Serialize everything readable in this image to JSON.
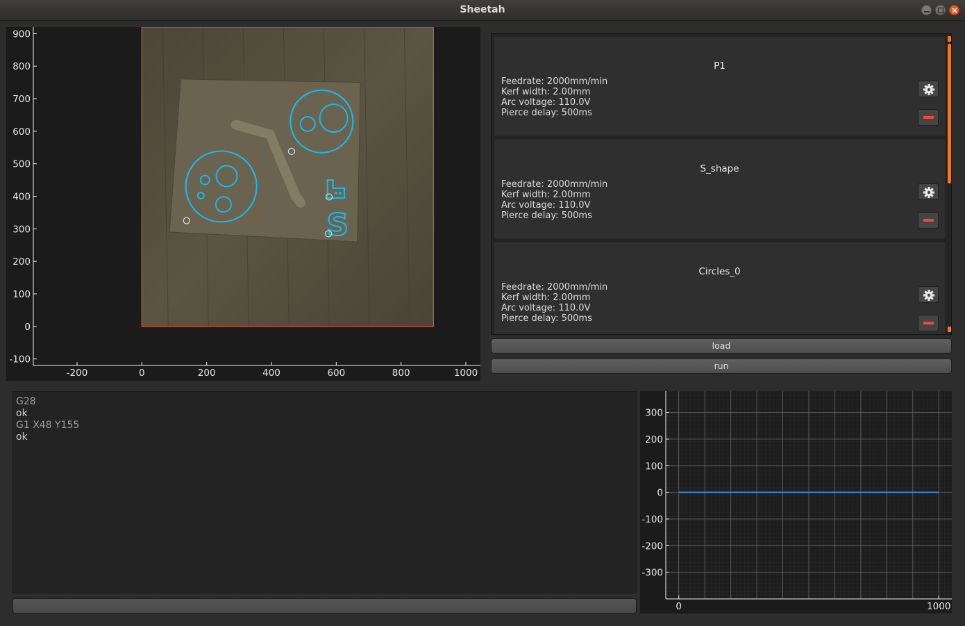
{
  "window": {
    "title": "Sheetah"
  },
  "main_plot": {
    "type": "scatter",
    "x_ticks": [
      "-200",
      "0",
      "200",
      "400",
      "600",
      "800",
      "1000"
    ],
    "y_ticks": [
      "900",
      "800",
      "700",
      "600",
      "500",
      "400",
      "300",
      "200",
      "100",
      "0",
      "-100"
    ],
    "xlim": [
      -335,
      1045
    ],
    "ylim": [
      -120,
      920
    ],
    "workspace": {
      "x0": 0,
      "y0": 0,
      "x1": 900,
      "y1": 920
    },
    "colors": {
      "border": "#e0502a",
      "contour": "#18b8e8",
      "photo": "#56503f"
    }
  },
  "jobs": [
    {
      "name": "P1",
      "feedrate": "Feedrate: 2000mm/min",
      "kerf": "Kerf width: 2.00mm",
      "arc": "Arc voltage: 110.0V",
      "pierce": "Pierce delay: 500ms"
    },
    {
      "name": "S_shape",
      "feedrate": "Feedrate: 2000mm/min",
      "kerf": "Kerf width: 2.00mm",
      "arc": "Arc voltage: 110.0V",
      "pierce": "Pierce delay: 500ms"
    },
    {
      "name": "Circles_0",
      "feedrate": "Feedrate: 2000mm/min",
      "kerf": "Kerf width: 2.00mm",
      "arc": "Arc voltage: 110.0V",
      "pierce": "Pierce delay: 500ms"
    }
  ],
  "buttons": {
    "load": "load",
    "run": "run"
  },
  "console": {
    "lines": [
      "G28",
      "ok",
      "G1 X48 Y155",
      "ok"
    ]
  },
  "chart_data": {
    "type": "line",
    "x_ticks": [
      "0",
      "1000"
    ],
    "y_ticks": [
      "300",
      "200",
      "100",
      "0",
      "-100",
      "-200",
      "-300"
    ],
    "xlim": [
      -50,
      1050
    ],
    "ylim": [
      -400,
      380
    ],
    "series": [
      {
        "x": [
          0,
          1000
        ],
        "y": [
          0,
          0
        ],
        "color": "#3d8fe6"
      }
    ]
  }
}
